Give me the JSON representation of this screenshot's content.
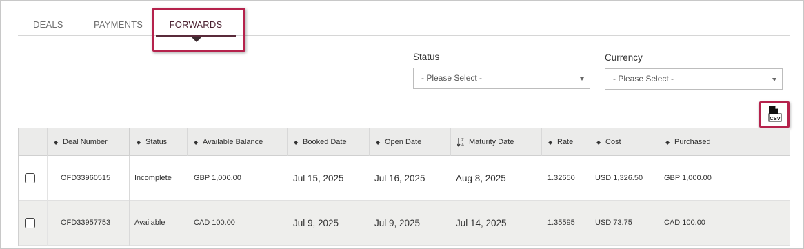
{
  "tabs": [
    {
      "label": "DEALS",
      "active": false
    },
    {
      "label": "PAYMENTS",
      "active": false
    },
    {
      "label": "FORWARDS",
      "active": true
    }
  ],
  "filters": {
    "status": {
      "label": "Status",
      "value": "- Please Select -"
    },
    "currency": {
      "label": "Currency",
      "value": "- Please Select -"
    }
  },
  "export": {
    "icon": "csv-file-icon",
    "text": "CSV"
  },
  "table": {
    "columns": [
      {
        "label": "Deal Number",
        "sort_icon": "sort-icon"
      },
      {
        "label": "Status",
        "sort_icon": "sort-icon"
      },
      {
        "label": "Available Balance",
        "sort_icon": "sort-icon"
      },
      {
        "label": "Booked Date",
        "sort_icon": "sort-icon"
      },
      {
        "label": "Open Date",
        "sort_icon": "sort-icon"
      },
      {
        "label": "Maturity Date",
        "sort_icon": "sort-z-a-icon"
      },
      {
        "label": "Rate",
        "sort_icon": "sort-icon"
      },
      {
        "label": "Cost",
        "sort_icon": "sort-icon"
      },
      {
        "label": "Purchased",
        "sort_icon": "sort-icon"
      }
    ],
    "rows": [
      {
        "deal_number": "OFD33960515",
        "status": "Incomplete",
        "available_balance": "GBP 1,000.00",
        "booked_date": "Jul 15, 2025",
        "open_date": "Jul 16, 2025",
        "maturity_date": "Aug 8, 2025",
        "rate": "1.32650",
        "cost": "USD 1,326.50",
        "purchased": "GBP 1,000.00",
        "checked": false,
        "link": false
      },
      {
        "deal_number": "OFD33957753",
        "status": "Available",
        "available_balance": "CAD 100.00",
        "booked_date": "Jul 9, 2025",
        "open_date": "Jul 9, 2025",
        "maturity_date": "Jul 14, 2025",
        "rate": "1.35595",
        "cost": "USD 73.75",
        "purchased": "CAD 100.00",
        "checked": false,
        "link": true
      }
    ]
  },
  "colors": {
    "accent": "#5a2a3a",
    "highlight": "#b5224c",
    "header_bg": "#ebebea",
    "alt_row_bg": "#eeeeec"
  }
}
